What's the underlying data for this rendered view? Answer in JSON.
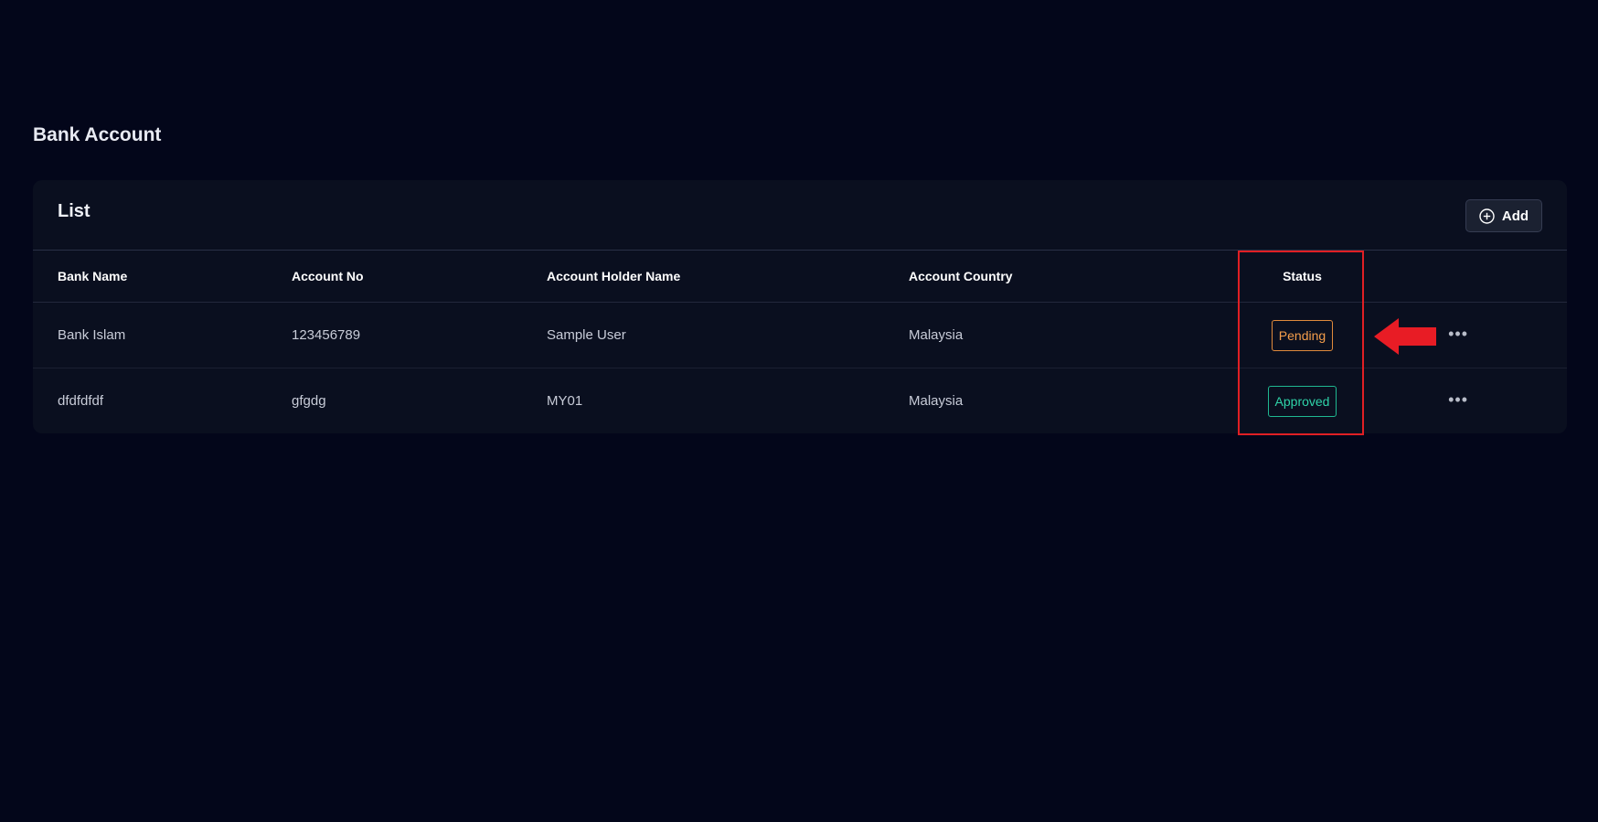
{
  "page": {
    "title": "Bank Account"
  },
  "card": {
    "title": "List",
    "add_button": {
      "label": "Add",
      "icon": "plus-circle-icon"
    }
  },
  "table": {
    "columns": [
      "Bank Name",
      "Account No",
      "Account Holder Name",
      "Account Country",
      "Status"
    ],
    "rows": [
      {
        "bank_name": "Bank Islam",
        "account_no": "123456789",
        "holder_name": "Sample User",
        "country": "Malaysia",
        "status": "Pending"
      },
      {
        "bank_name": "dfdfdfdf",
        "account_no": "gfgdg",
        "holder_name": "MY01",
        "country": "Malaysia",
        "status": "Approved"
      }
    ],
    "row_action_icon": "more-horizontal-icon"
  },
  "colors": {
    "background": "#03061a",
    "card": "#0a0f1f",
    "pending": "#f59e4b",
    "approved": "#2fd3a8",
    "annotation": "#e01f24"
  },
  "annotations": {
    "highlight": "status-column",
    "arrow_icon": "left-arrow-icon"
  }
}
